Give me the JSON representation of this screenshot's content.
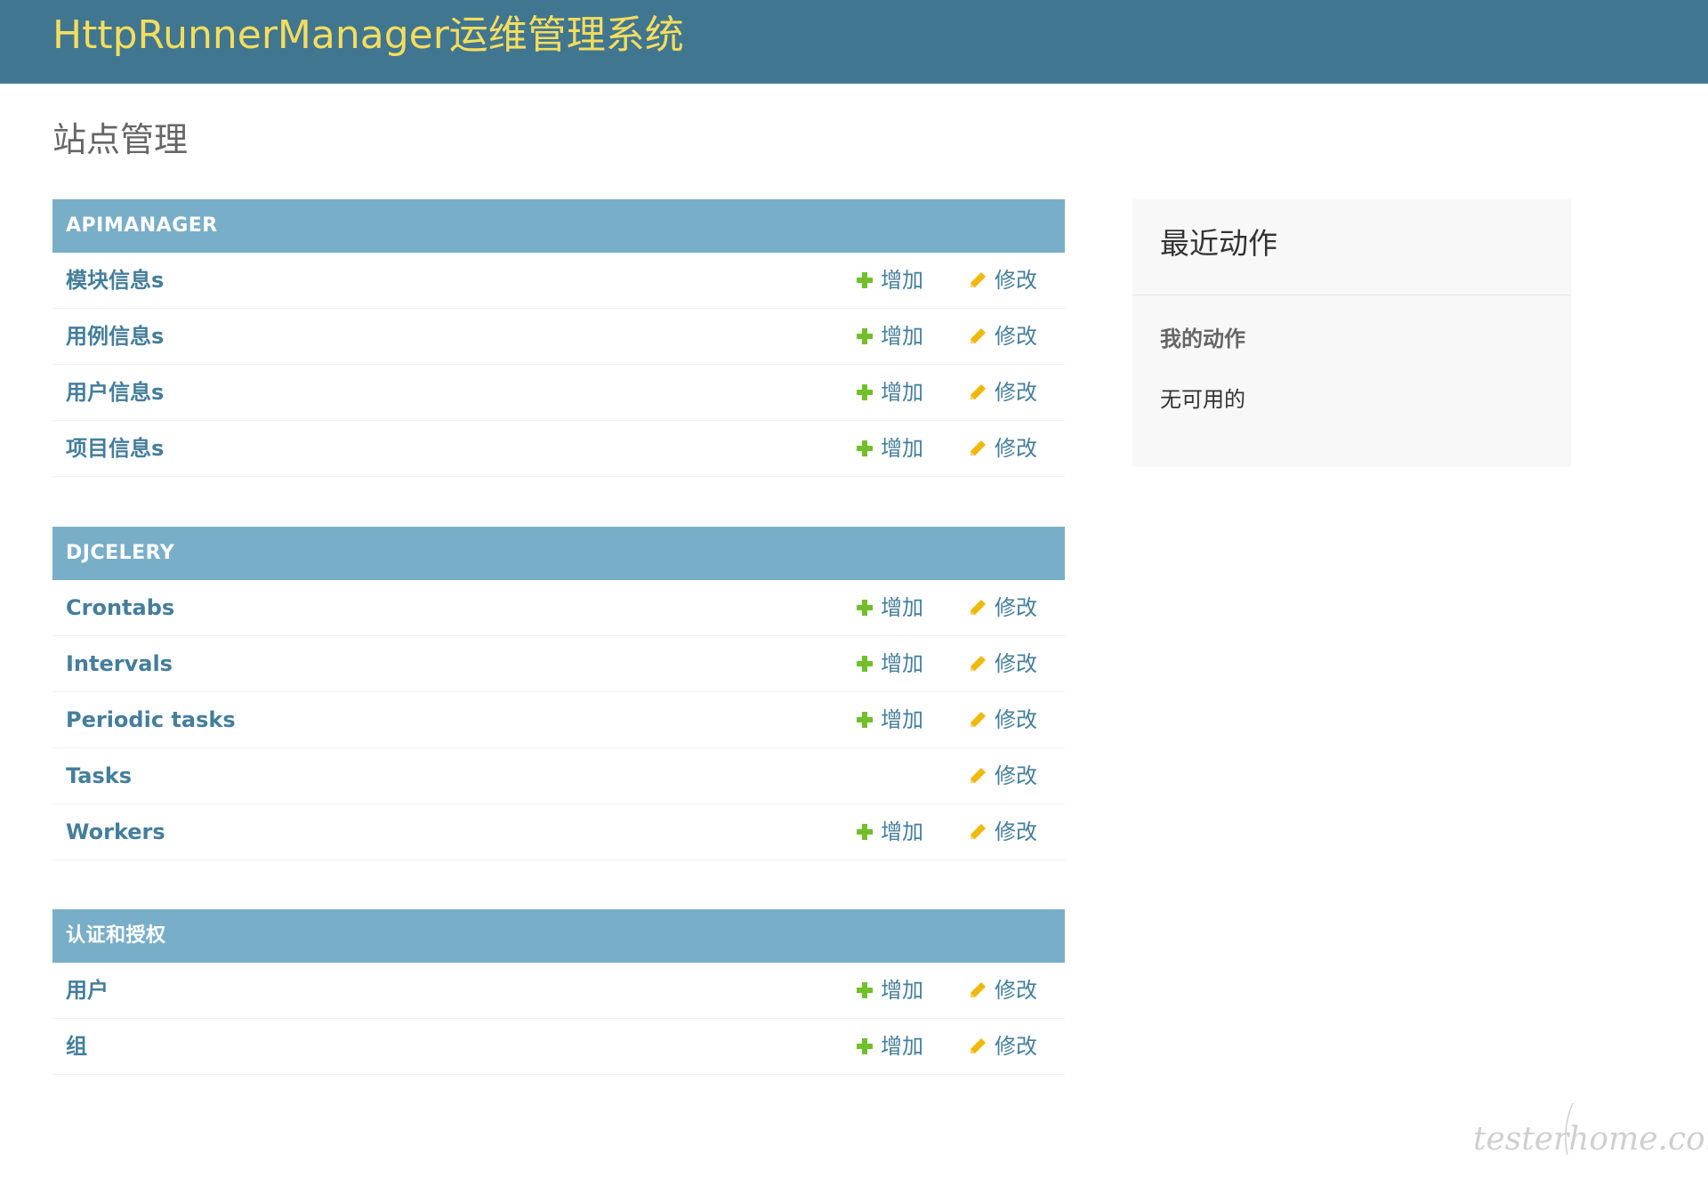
{
  "header": {
    "site_name": "HttpRunnerManager运维管理系统"
  },
  "page": {
    "title": "站点管理"
  },
  "apps": [
    {
      "caption": "APIMANAGER",
      "models": [
        {
          "name": "模块信息s",
          "add_label": "增加",
          "change_label": "修改"
        },
        {
          "name": "用例信息s",
          "add_label": "增加",
          "change_label": "修改"
        },
        {
          "name": "用户信息s",
          "add_label": "增加",
          "change_label": "修改"
        },
        {
          "name": "项目信息s",
          "add_label": "增加",
          "change_label": "修改"
        }
      ]
    },
    {
      "caption": "DJCELERY",
      "models": [
        {
          "name": "Crontabs",
          "add_label": "增加",
          "change_label": "修改"
        },
        {
          "name": "Intervals",
          "add_label": "增加",
          "change_label": "修改"
        },
        {
          "name": "Periodic tasks",
          "add_label": "增加",
          "change_label": "修改"
        },
        {
          "name": "Tasks",
          "add_label": null,
          "change_label": "修改"
        },
        {
          "name": "Workers",
          "add_label": "增加",
          "change_label": "修改"
        }
      ]
    },
    {
      "caption": "认证和授权",
      "models": [
        {
          "name": "用户",
          "add_label": "增加",
          "change_label": "修改"
        },
        {
          "name": "组",
          "add_label": "增加",
          "change_label": "修改"
        }
      ]
    }
  ],
  "recent_actions": {
    "title": "最近动作",
    "my_actions_label": "我的动作",
    "empty_text": "无可用的"
  },
  "watermark": {
    "text": "testerhome.com"
  },
  "colors": {
    "header_bg": "#417690",
    "site_name": "#f5dd5d",
    "caption_bg": "#79aec8",
    "link": "#447e9b",
    "add_icon": "#70bf2b",
    "change_icon": "#efb80b"
  }
}
